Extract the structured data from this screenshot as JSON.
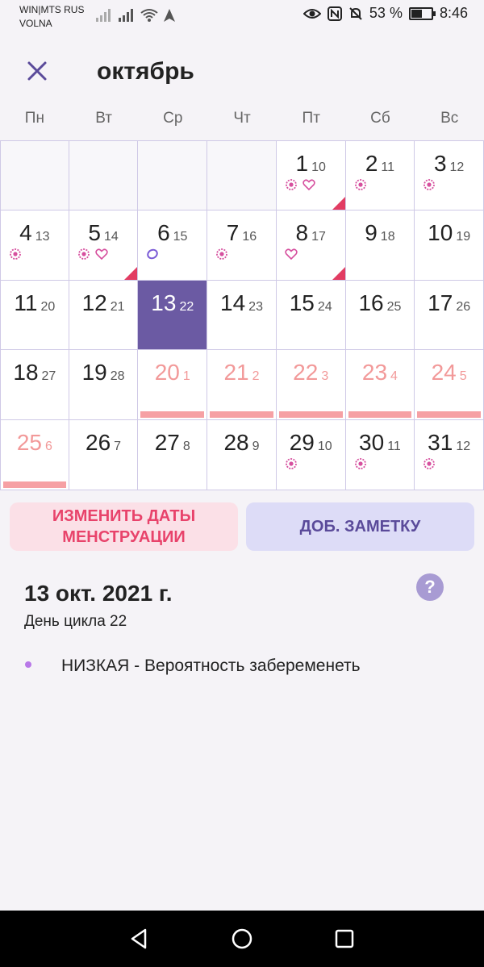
{
  "status": {
    "carrier_line1": "WIN|MTS RUS",
    "carrier_line2": "VOLNA",
    "battery": "53 %",
    "time": "8:46"
  },
  "header": {
    "month": "октябрь"
  },
  "weekdays": [
    "Пн",
    "Вт",
    "Ср",
    "Чт",
    "Пт",
    "Сб",
    "Вс"
  ],
  "calendar": {
    "rows": [
      [
        null,
        null,
        null,
        null,
        {
          "day": "1",
          "cycle": "10",
          "marks": [
            "flower",
            "heart"
          ],
          "flag": true
        },
        {
          "day": "2",
          "cycle": "11",
          "marks": [
            "flower"
          ]
        },
        {
          "day": "3",
          "cycle": "12",
          "marks": [
            "flower"
          ]
        }
      ],
      [
        {
          "day": "4",
          "cycle": "13",
          "marks": [
            "flower"
          ]
        },
        {
          "day": "5",
          "cycle": "14",
          "marks": [
            "flower",
            "heart"
          ],
          "flag": true
        },
        {
          "day": "6",
          "cycle": "15",
          "marks": [
            "ovulation"
          ]
        },
        {
          "day": "7",
          "cycle": "16",
          "marks": [
            "flower"
          ]
        },
        {
          "day": "8",
          "cycle": "17",
          "marks": [
            "heart"
          ],
          "flag": true
        },
        {
          "day": "9",
          "cycle": "18"
        },
        {
          "day": "10",
          "cycle": "19"
        }
      ],
      [
        {
          "day": "11",
          "cycle": "20"
        },
        {
          "day": "12",
          "cycle": "21"
        },
        {
          "day": "13",
          "cycle": "22",
          "selected": true
        },
        {
          "day": "14",
          "cycle": "23"
        },
        {
          "day": "15",
          "cycle": "24"
        },
        {
          "day": "16",
          "cycle": "25"
        },
        {
          "day": "17",
          "cycle": "26"
        }
      ],
      [
        {
          "day": "18",
          "cycle": "27"
        },
        {
          "day": "19",
          "cycle": "28"
        },
        {
          "day": "20",
          "cycle": "1",
          "period": true
        },
        {
          "day": "21",
          "cycle": "2",
          "period": true
        },
        {
          "day": "22",
          "cycle": "3",
          "period": true
        },
        {
          "day": "23",
          "cycle": "4",
          "period": true
        },
        {
          "day": "24",
          "cycle": "5",
          "period": true
        }
      ],
      [
        {
          "day": "25",
          "cycle": "6",
          "period": true
        },
        {
          "day": "26",
          "cycle": "7"
        },
        {
          "day": "27",
          "cycle": "8"
        },
        {
          "day": "28",
          "cycle": "9"
        },
        {
          "day": "29",
          "cycle": "10",
          "marks": [
            "flower"
          ]
        },
        {
          "day": "30",
          "cycle": "11",
          "marks": [
            "flower"
          ]
        },
        {
          "day": "31",
          "cycle": "12",
          "marks": [
            "flower"
          ]
        }
      ]
    ]
  },
  "actions": {
    "edit_period_line1": "ИЗМЕНИТЬ ДАТЫ",
    "edit_period_line2": "МЕНСТРУАЦИИ",
    "add_note": "ДОБ. ЗАМЕТКУ"
  },
  "details": {
    "date": "13 окт. 2021 г.",
    "cycle_day": "День цикла 22",
    "probability": "НИЗКАЯ - Вероятность забеременеть",
    "help": "?"
  },
  "colors": {
    "accent": "#6b5aa3",
    "period": "#f29999",
    "flag": "#e23c62",
    "flower": "#d64f9e"
  }
}
